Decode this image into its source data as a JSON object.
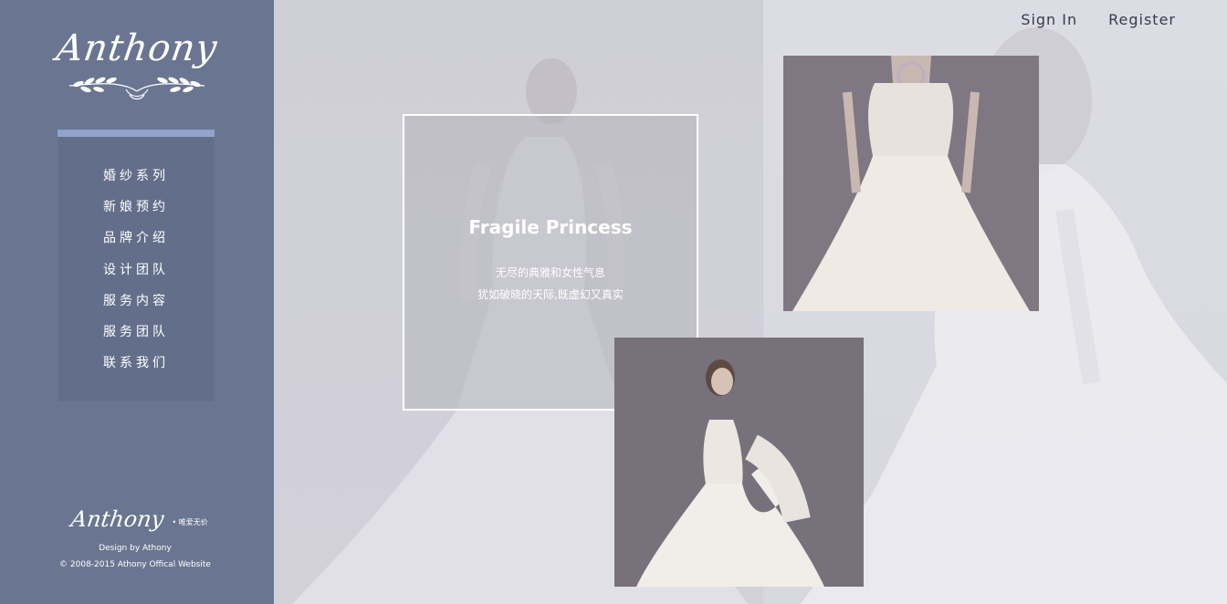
{
  "logo": {
    "text": "Anthony"
  },
  "nav": {
    "items": [
      {
        "label": "婚纱系列"
      },
      {
        "label": "新娘预约"
      },
      {
        "label": "品牌介绍"
      },
      {
        "label": "设计团队"
      },
      {
        "label": "服务内容"
      },
      {
        "label": "服务团队"
      },
      {
        "label": "联系我们"
      }
    ]
  },
  "footer": {
    "logo_text": "Anthony",
    "tagline": "• 唯爱无价",
    "design_credit": "Design by Athony",
    "copyright": "© 2008-2015 Athony Offical Website"
  },
  "topnav": {
    "sign_in": "Sign In",
    "register": "Register"
  },
  "feature": {
    "title": "Fragile Princess",
    "line1": "无尽的典雅和女性气息",
    "line2": "犹如破晓的天际,既虚幻又真实"
  },
  "colors": {
    "sidebar": "#6a7691",
    "nav_panel": "#636f8a",
    "nav_accent": "#8fa3cc"
  }
}
